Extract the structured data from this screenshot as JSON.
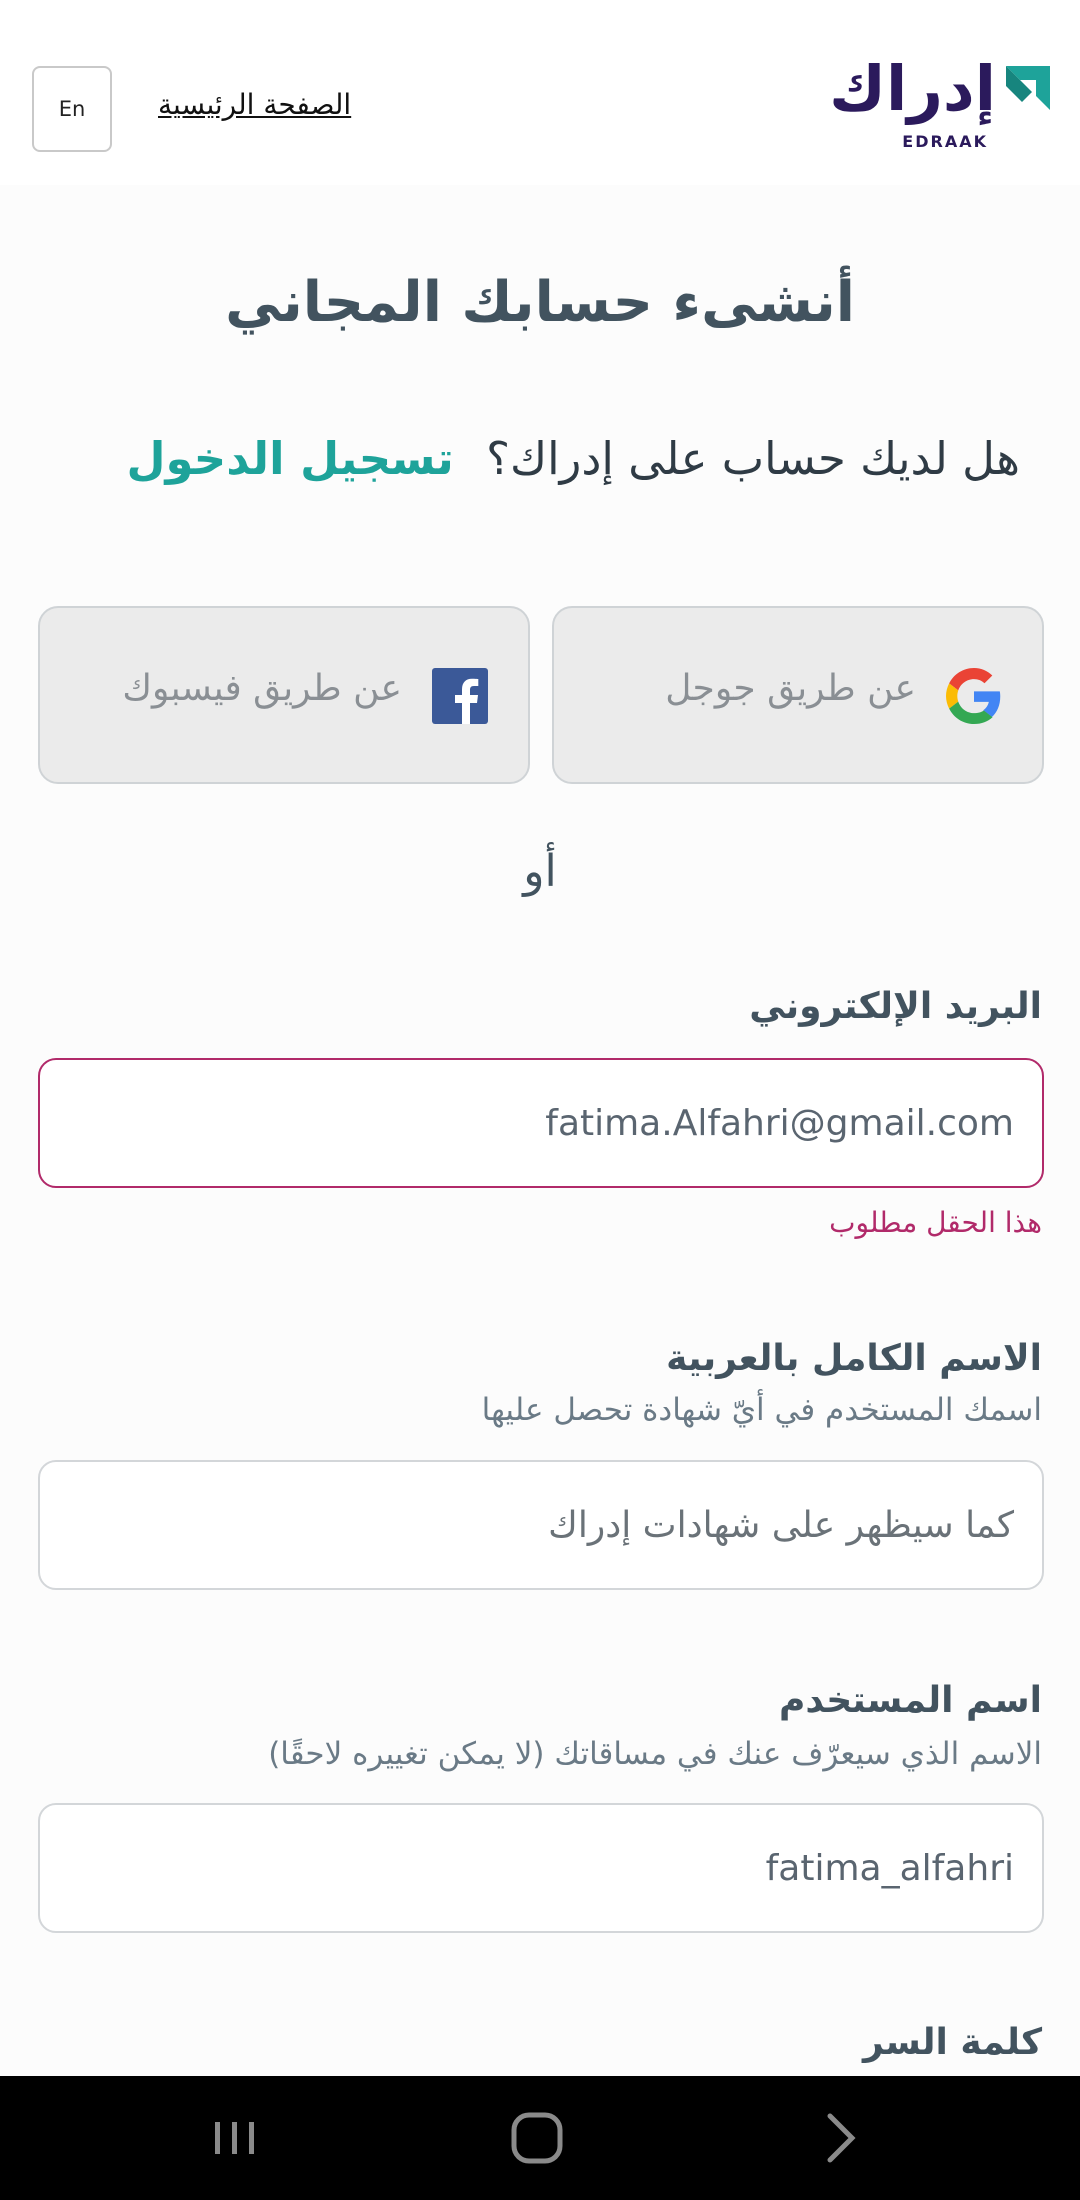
{
  "header": {
    "lang_button": "En",
    "home_link": "الصفحة الرئيسية",
    "logo_text": "إدراك",
    "logo_subtext": "EDRAAK"
  },
  "title": "أنشىء حسابك المجاني",
  "login_prompt": {
    "question": "هل لديك حساب على إدراك؟",
    "link": "تسجيل الدخول"
  },
  "social": {
    "google_label": "عن طريق جوجل",
    "facebook_label": "عن طريق فيسبوك"
  },
  "or_text": "أو",
  "email": {
    "label": "البريد الإلكتروني",
    "value": "fatima.Alfahri@gmail.com",
    "error": "هذا الحقل مطلوب"
  },
  "full_name": {
    "label": "الاسم الكامل بالعربية",
    "hint": "اسمك المستخدم في أيّ شهادة تحصل عليها",
    "placeholder": "كما سيظهر على شهادات إدراك"
  },
  "username": {
    "label": "اسم المستخدم",
    "hint": "الاسم الذي سيعرّف عنك في مساقاتك (لا يمكن تغييره لاحقًا)",
    "value": "fatima_alfahri"
  },
  "password": {
    "label": "كلمة السر"
  },
  "colors": {
    "accent": "#1ea39a",
    "brand": "#2b1a5c",
    "error": "#b12a6a",
    "heading": "#42535f"
  },
  "icons": {
    "logo": "edraak-logo-icon",
    "google": "google-icon",
    "facebook": "facebook-icon",
    "nav_recents": "recents-icon",
    "nav_home": "home-circle-icon",
    "nav_back": "back-chevron-icon"
  }
}
